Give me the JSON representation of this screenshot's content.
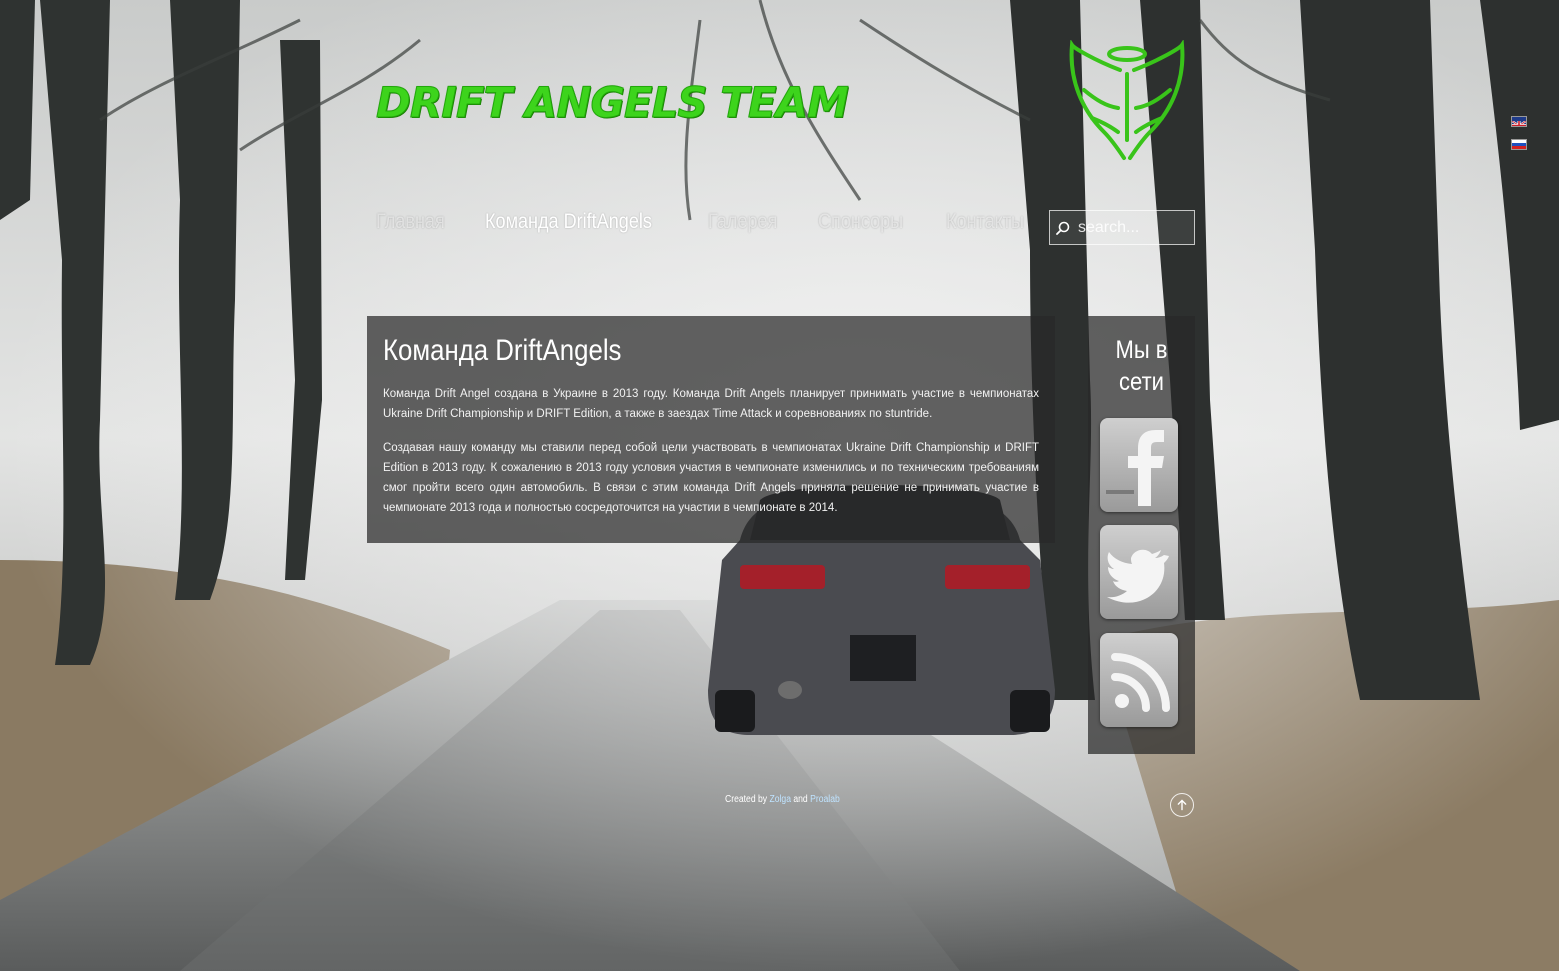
{
  "header": {
    "title": "DRIFT ANGELS TEAM",
    "logo_icon": "angel-wings-logo",
    "brand_color": "#3dd41c",
    "languages": [
      {
        "code": "en",
        "icon": "uk-flag-icon"
      },
      {
        "code": "ru",
        "icon": "russia-flag-icon"
      }
    ]
  },
  "nav": {
    "items": [
      {
        "label": "Главная",
        "active": false
      },
      {
        "label": "Команда DriftAngels",
        "active": true
      },
      {
        "label": "Галерея",
        "active": false
      },
      {
        "label": "Спонсоры",
        "active": false
      },
      {
        "label": "Контакты",
        "active": false
      }
    ]
  },
  "search": {
    "placeholder": "search...",
    "icon": "search-icon"
  },
  "main": {
    "heading": "Команда DriftAngels",
    "paragraphs": [
      "Команда Drift Angel создана в Украине в 2013 году. Команда Drift Angels планирует принимать участие в чемпионатах Ukraine Drift Championship и DRIFT Edition, а также в заездах Time Attack и соревнованиях по stuntride.",
      "Создавая нашу команду мы ставили перед собой цели участвовать в чемпионатах Ukraine Drift Championship и DRIFT Edition в 2013 году. К сожалению в 2013 году условия участия в чемпионате изменились и по техническим требованиям смог пройти всего один автомобиль. В связи с этим команда Drift Angels приняла решение не принимать участие в чемпионате 2013 года и полностью сосредоточится на участии в чемпионате в 2014."
    ]
  },
  "sidebar": {
    "title": "Мы в сети",
    "links": [
      {
        "icon": "facebook-icon"
      },
      {
        "icon": "twitter-icon"
      },
      {
        "icon": "rss-icon"
      }
    ]
  },
  "footer": {
    "prefix": "Created by",
    "author1": "Zolga",
    "joiner": "and",
    "author2": "Proalab",
    "totop_icon": "arrow-up-icon"
  }
}
